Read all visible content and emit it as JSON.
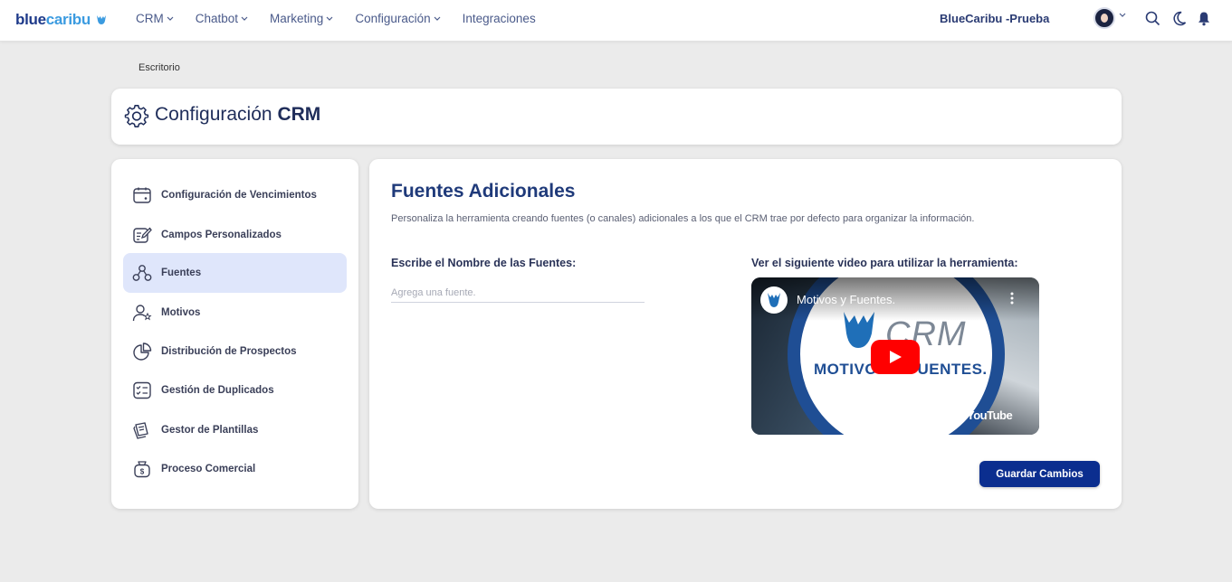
{
  "app": {
    "logo_part1": "blue",
    "logo_part2": "caribu",
    "logo_icon": "caribou-icon"
  },
  "nav": {
    "items": [
      {
        "label": "CRM",
        "has_dropdown": true
      },
      {
        "label": "Chatbot",
        "has_dropdown": true
      },
      {
        "label": "Marketing",
        "has_dropdown": true
      },
      {
        "label": "Configuración",
        "has_dropdown": true
      },
      {
        "label": "Integraciones",
        "has_dropdown": false
      }
    ],
    "org_name": "BlueCaribu -Prueba",
    "icons": [
      "avatar",
      "chevron-down-icon",
      "search-icon",
      "moon-icon",
      "bell-icon"
    ]
  },
  "breadcrumb": "Escritorio",
  "page": {
    "title_light": "Configuración",
    "title_bold": "CRM",
    "icon": "gear-icon"
  },
  "sidebar": {
    "items": [
      {
        "label": "Configuración de Vencimientos",
        "icon": "calendar-icon",
        "active": false
      },
      {
        "label": "Campos Personalizados",
        "icon": "edit-note-icon",
        "active": false
      },
      {
        "label": "Fuentes",
        "icon": "network-icon",
        "active": true
      },
      {
        "label": "Motivos",
        "icon": "user-star-icon",
        "active": false
      },
      {
        "label": "Distribución de Prospectos",
        "icon": "pie-chart-icon",
        "active": false
      },
      {
        "label": "Gestión de Duplicados",
        "icon": "checklist-icon",
        "active": false
      },
      {
        "label": "Gestor de Plantillas",
        "icon": "template-icon",
        "active": false
      },
      {
        "label": "Proceso Comercial",
        "icon": "money-bag-icon",
        "active": false
      }
    ]
  },
  "main": {
    "title": "Fuentes Adicionales",
    "description": "Personaliza la herramienta creando fuentes (o canales) adicionales a los que el CRM trae por defecto para organizar la información.",
    "field_label": "Escribe el Nombre de las Fuentes:",
    "field_placeholder": "Agrega una fuente.",
    "field_value": "",
    "video_label": "Ver el siguiente video para utilizar la herramienta:",
    "video": {
      "title": "Motivos y Fuentes.",
      "overlay_text": "CRM",
      "overlay_sub": "MOTIVOS Y FUENTES.",
      "platform": "YouTube"
    },
    "save_button": "Guardar Cambios"
  },
  "colors": {
    "accent": "#0b2e8f",
    "active_bg": "#dfe6fb",
    "title": "#1f3a7a",
    "background": "#ebebeb"
  }
}
